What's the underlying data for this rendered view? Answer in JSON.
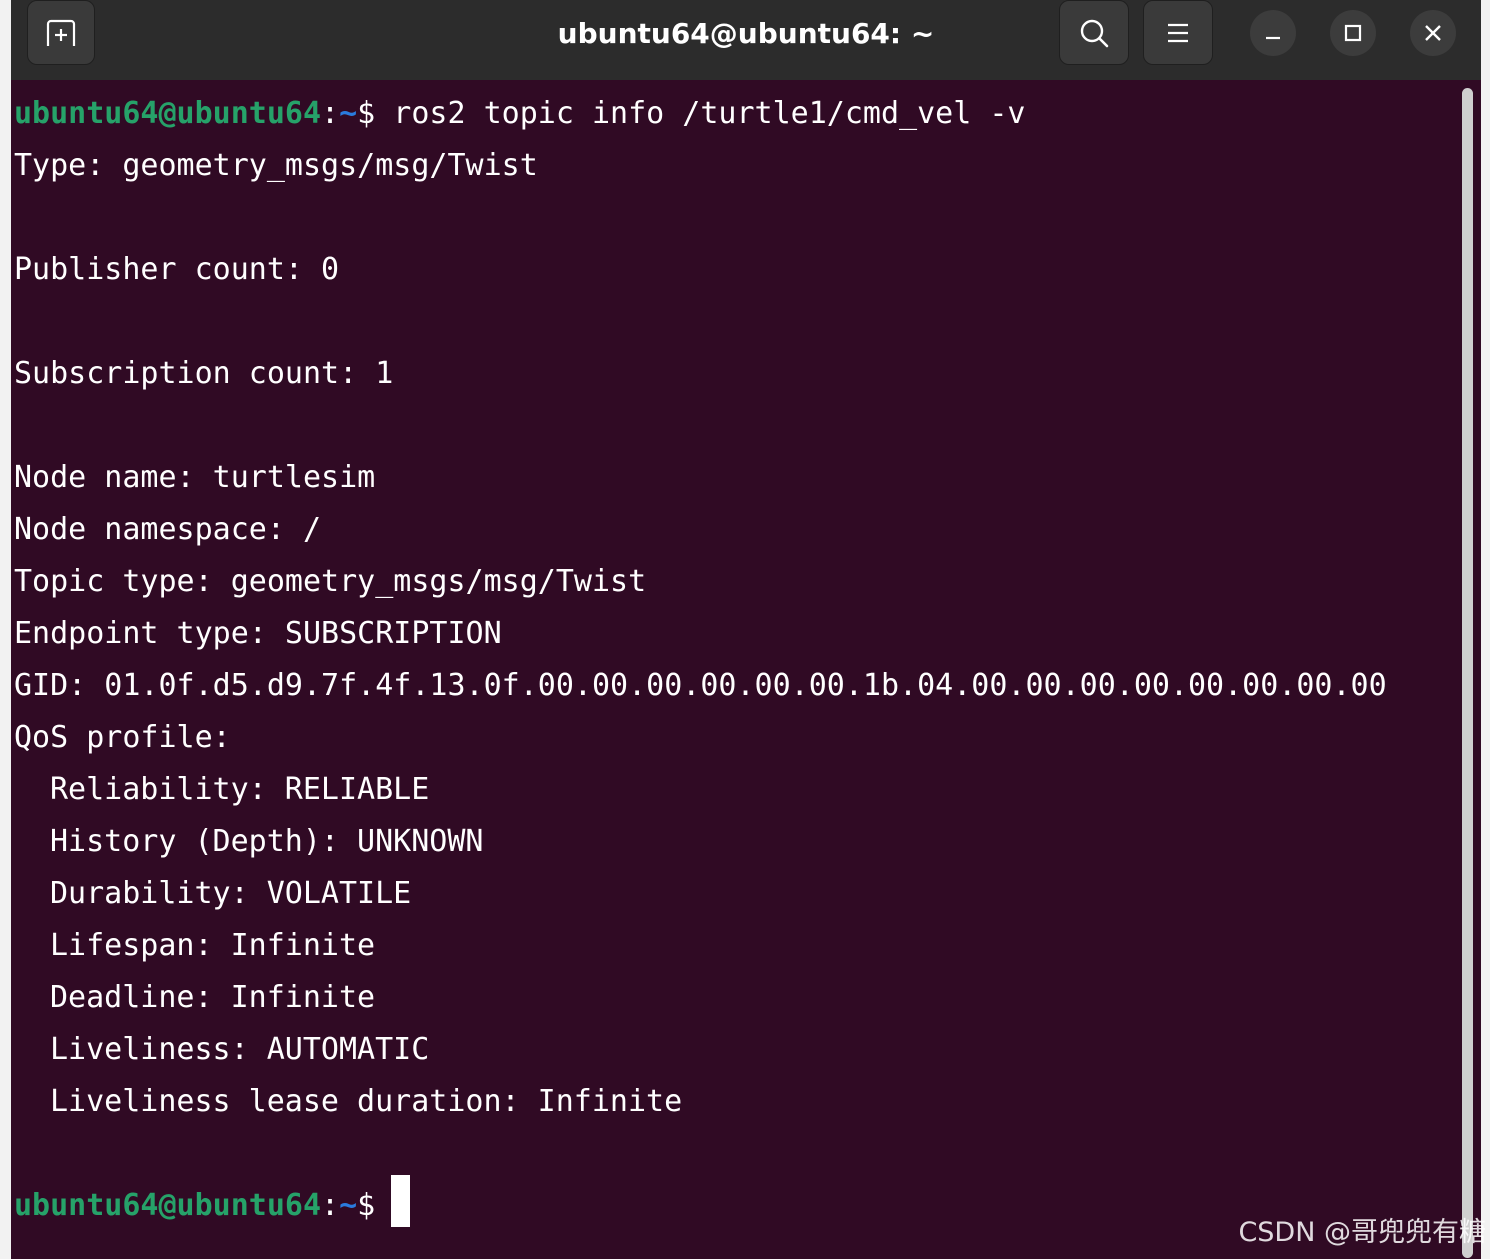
{
  "window": {
    "title": "ubuntu64@ubuntu64: ~"
  },
  "icons": {
    "new_tab": "new-tab-icon",
    "search": "search-icon",
    "menu": "hamburger-menu-icon",
    "minimize": "minimize-icon",
    "maximize": "maximize-icon",
    "close": "close-icon"
  },
  "colors": {
    "terminal_bg": "#300a24",
    "titlebar_bg": "#2c2c2c",
    "prompt_user": "#26a269",
    "prompt_path": "#2a7bde",
    "text": "#ffffff"
  },
  "terminal": {
    "prompt_user": "ubuntu64@ubuntu64",
    "prompt_colon": ":",
    "prompt_path": "~",
    "prompt_symbol": "$",
    "command": " ros2 topic info /turtle1/cmd_vel -v",
    "output": [
      "Type: geometry_msgs/msg/Twist",
      "Publisher count: 0",
      "Subscription count: 1",
      "Node name: turtlesim",
      "Node namespace: /",
      "Topic type: geometry_msgs/msg/Twist",
      "Endpoint type: SUBSCRIPTION",
      "GID: 01.0f.d5.d9.7f.4f.13.0f.00.00.00.00.00.00.1b.04.00.00.00.00.00.00.00.00",
      "QoS profile:",
      "Reliability: RELIABLE",
      "History (Depth): UNKNOWN",
      "Durability: VOLATILE",
      "Lifespan: Infinite",
      "Deadline: Infinite",
      "Liveliness: AUTOMATIC",
      "Liveliness lease duration: Infinite"
    ]
  },
  "watermark": "CSDN @哥兜兜有糖"
}
